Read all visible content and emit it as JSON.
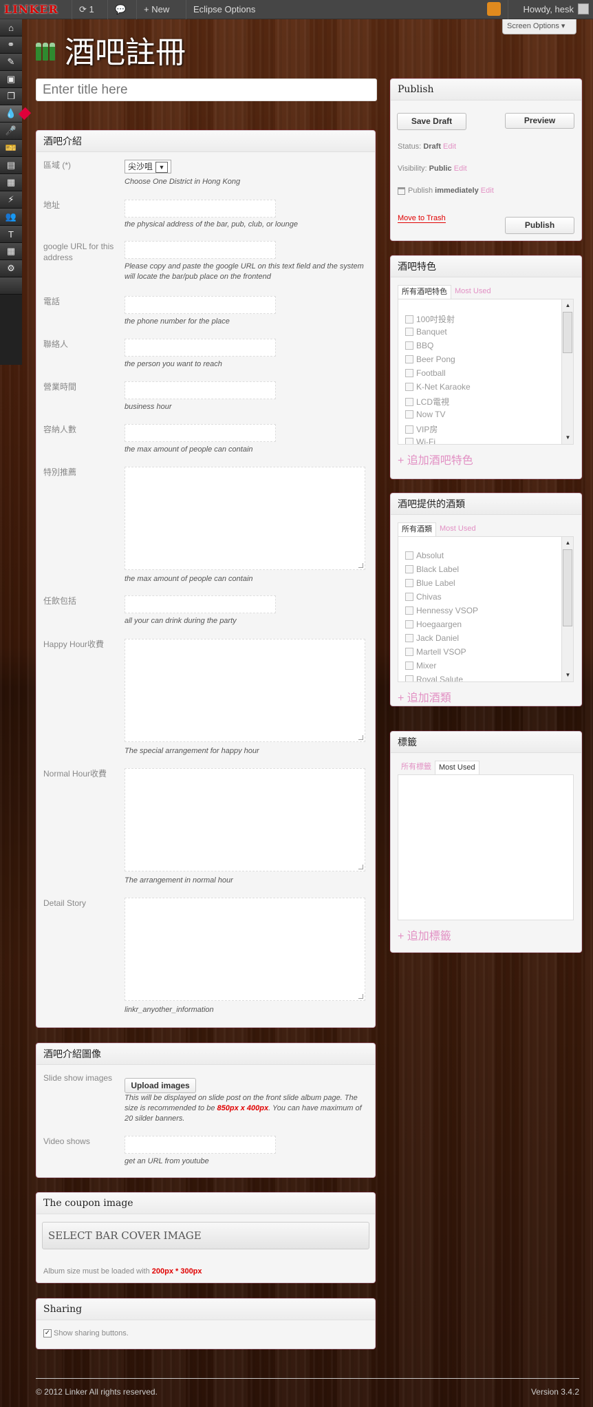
{
  "adminbar": {
    "logo": "LINKER",
    "updates_count": "1",
    "new_label": "New",
    "eclipse_label": "Eclipse Options",
    "howdy": "Howdy, hesk"
  },
  "screen_options": "Screen Options",
  "page": {
    "title": "酒吧註冊",
    "title_placeholder": "Enter title here"
  },
  "bar_info": {
    "title": "酒吧介紹",
    "district": {
      "label": "區域 (*)",
      "value": "尖沙咀",
      "desc": "Choose One District in Hong Kong"
    },
    "address": {
      "label": "地址",
      "desc": "the physical address of the bar, pub, club, or lounge"
    },
    "google": {
      "label": "google URL for this address",
      "desc": "Please copy and paste the google URL on this text field and the system will locate the bar/pub place on the frontend"
    },
    "phone": {
      "label": "電話",
      "desc": "the phone number for the place"
    },
    "contact": {
      "label": "聯絡人",
      "desc": "the person you want to reach"
    },
    "hours": {
      "label": "營業時間",
      "desc": "business hour"
    },
    "capacity": {
      "label": "容納人數",
      "desc": "the max amount of people can contain"
    },
    "special": {
      "label": "特別推薦",
      "desc": "the max amount of people can contain"
    },
    "free_drink": {
      "label": "任飲包括",
      "desc": "all your can drink during the party"
    },
    "happy_hour": {
      "label": "Happy Hour收費",
      "desc": "The special arrangement for happy hour"
    },
    "normal_hour": {
      "label": "Normal Hour收費",
      "desc": "The arrangement in normal hour"
    },
    "detail": {
      "label": "Detail Story",
      "desc": "linkr_anyother_information"
    }
  },
  "images": {
    "title": "酒吧介紹圖像",
    "slide_label": "Slide show images",
    "upload_button": "Upload images",
    "slide_desc_1": "This will be displayed on slide post on the front slide album page. The size is recommended to be ",
    "slide_size": "850px x 400px",
    "slide_desc_2": ". You can have maximum of 20 silder banners.",
    "video_label": "Video shows",
    "video_desc": "get an URL from youtube"
  },
  "coupon": {
    "title": "The coupon image",
    "select": "SELECT BAR COVER IMAGE",
    "size_note": "Album size must be loaded with ",
    "size": "200px * 300px"
  },
  "sharing": {
    "title": "Sharing",
    "checkbox": "Show sharing buttons."
  },
  "publish": {
    "title": "Publish",
    "save_draft": "Save Draft",
    "preview": "Preview",
    "status_label": "Status:",
    "status": "Draft",
    "visibility_label": "Visibility:",
    "visibility": "Public",
    "publish_label": "Publish",
    "publish_when": "immediately",
    "edit": "Edit",
    "trash": "Move to Trash",
    "publish_button": "Publish"
  },
  "features": {
    "title": "酒吧特色",
    "tab_all": "所有酒吧特色",
    "tab_most": "Most Used",
    "items": [
      "100吋投射",
      "Banquet",
      "BBQ",
      "Beer Pong",
      "Football",
      "K-Net Karaoke",
      "LCD電視",
      "Now TV",
      "VIP房",
      "Wi-Fi"
    ],
    "add": "+ 追加酒吧特色"
  },
  "drinks": {
    "title": "酒吧提供的酒類",
    "tab_all": "所有酒類",
    "tab_most": "Most Used",
    "items": [
      "Absolut",
      "Black Label",
      "Blue Label",
      "Chivas",
      "Hennessy VSOP",
      "Hoegaargen",
      "Jack Daniel",
      "Martell VSOP",
      "Mixer",
      "Royal Salute"
    ],
    "add": "+ 追加酒類"
  },
  "tags": {
    "title": "標籤",
    "tab_all": "所有標籤",
    "tab_most": "Most Used",
    "add": "+ 追加標籤"
  },
  "footer": {
    "copyright": "© 2012 Linker All rights reserved.",
    "version": "Version 3.4.2"
  }
}
